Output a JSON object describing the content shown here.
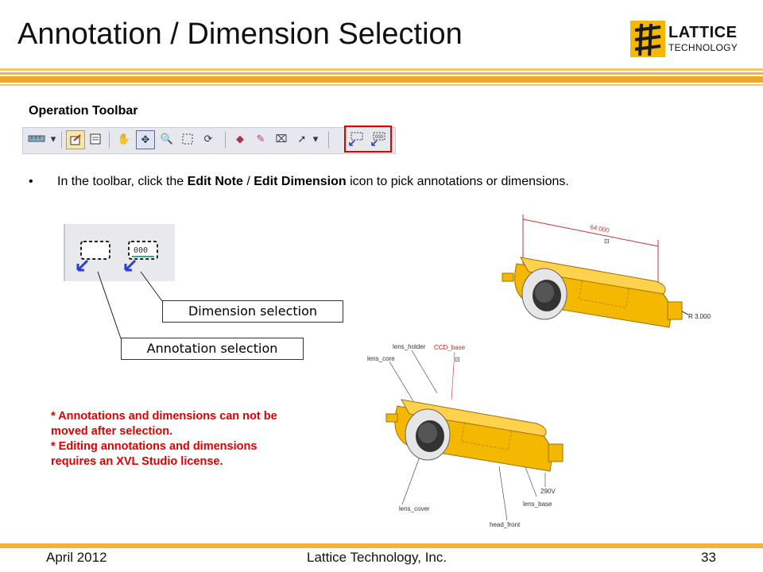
{
  "slide": {
    "title": "Annotation / Dimension Selection",
    "logo": {
      "line1": "LATTICE",
      "line2": "TECHNOLOGY"
    },
    "section_heading": "Operation Toolbar",
    "bullet": {
      "prefix": "In the toolbar, click the ",
      "bold1": "Edit Note",
      "sep": " / ",
      "bold2": "Edit Dimension",
      "suffix": " icon to pick annotations or dimensions."
    },
    "callouts": {
      "dimension": "Dimension selection",
      "annotation": "Annotation selection"
    },
    "note": {
      "line1": "*  Annotations and dimensions can not be",
      "line2": "moved after selection.",
      "line3": "*  Editing annotations and dimensions",
      "line4": "requires an XVL Studio license."
    },
    "model_top": {
      "dim_value": "64.000",
      "radius": "R 3.000"
    },
    "model_bottom": {
      "labels": [
        "lens_holder",
        "lens_core",
        "CCD_base",
        "lens_cover",
        "lens_base",
        "head_front",
        "290V"
      ]
    },
    "footer": {
      "date": "April 2012",
      "company": "Lattice Technology, Inc.",
      "page": "33"
    },
    "colors": {
      "accent_orange": "#f2b43c",
      "highlight_red": "#e00000",
      "model_yellow": "#f5b800"
    }
  },
  "toolbar_icons": [
    "ruler-icon",
    "dropdown-icon",
    "note-icon",
    "sheet-icon",
    "hand-icon",
    "move-icon",
    "zoom-icon",
    "rect-select-icon",
    "rotate-icon",
    "paint-icon",
    "brush-icon",
    "eraser-icon",
    "pointer-icon",
    "dropdown-icon",
    "edit-note-icon",
    "edit-dimension-icon"
  ]
}
